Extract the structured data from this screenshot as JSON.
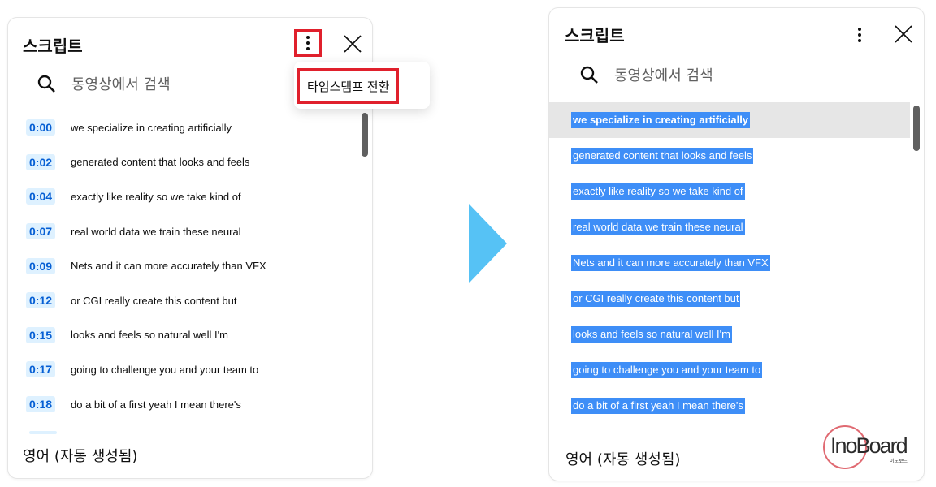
{
  "left_panel": {
    "title": "스크립트",
    "search_placeholder": "동영상에서 검색",
    "menu": {
      "toggle_timestamps_label": "타임스탬프 전환"
    },
    "segments": [
      {
        "time": "0:00",
        "text": "we specialize in creating artificially"
      },
      {
        "time": "0:02",
        "text": "generated content that looks and feels"
      },
      {
        "time": "0:04",
        "text": "exactly like reality so we take kind of"
      },
      {
        "time": "0:07",
        "text": "real world data we train these neural"
      },
      {
        "time": "0:09",
        "text": "Nets and it can more accurately than VFX"
      },
      {
        "time": "0:12",
        "text": "or CGI really create this content but"
      },
      {
        "time": "0:15",
        "text": "looks and feels so natural well I'm"
      },
      {
        "time": "0:17",
        "text": "going to challenge you and your team to"
      },
      {
        "time": "0:18",
        "text": "do a bit of a first yeah I mean there's"
      }
    ],
    "footer_language": "영어 (자동 생성됨)"
  },
  "right_panel": {
    "title": "스크립트",
    "search_placeholder": "동영상에서 검색",
    "selected_lines": [
      "we specialize in creating artificially",
      "generated content that looks and feels",
      "exactly like reality so we take kind of",
      "real world data we train these neural",
      "Nets and it can more accurately than VFX",
      "or CGI really create this content but",
      "looks and feels so natural well I'm",
      "going to challenge you and your team to",
      "do a bit of a first yeah I mean there's"
    ],
    "footer_language": "영어 (자동 생성됨)"
  },
  "brand": {
    "name": "InoBoard",
    "sub": "이노보드"
  },
  "colors": {
    "highlight_red": "#e0202c",
    "timestamp_bg": "#def1ff",
    "timestamp_text": "#065fd4",
    "selection_blue": "#3e8ef7",
    "arrow_blue": "#56c2f5"
  },
  "icons": {
    "more": "more-vert-icon",
    "close": "close-icon",
    "search": "search-icon",
    "arrow": "right-arrow-icon"
  }
}
